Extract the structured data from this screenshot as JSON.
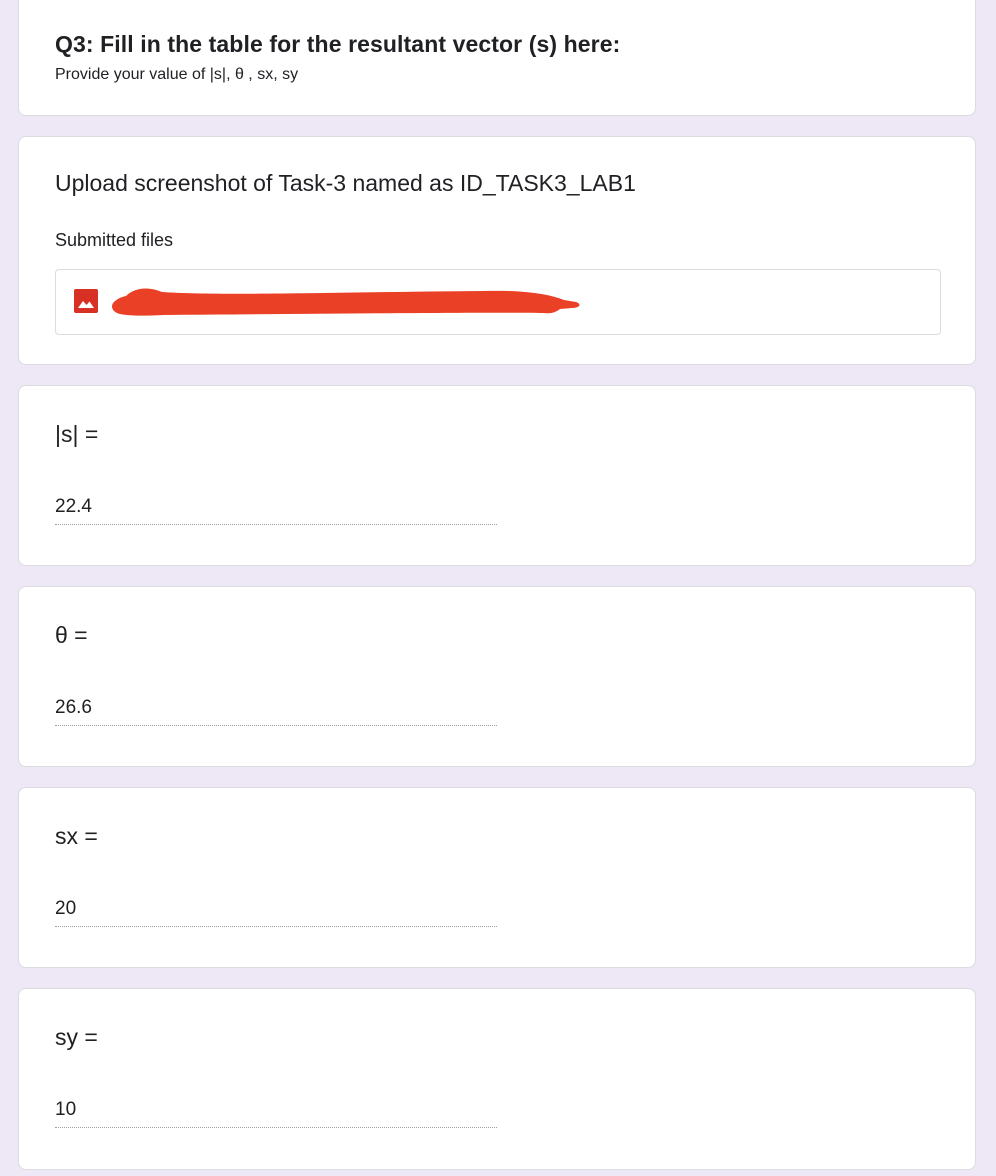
{
  "section": {
    "title": "Q3: Fill in the table for the resultant vector (s) here:",
    "description": "Provide your value of |s|, θ , sx, sy"
  },
  "upload_question": {
    "title": "Upload screenshot of Task-3 named as  ID_TASK3_LAB1",
    "submitted_label": "Submitted files",
    "file_icon": "image-icon",
    "file_name_redacted": true
  },
  "questions": [
    {
      "label": "|s| =",
      "value": "22.4"
    },
    {
      "label": "θ =",
      "value": "26.6"
    },
    {
      "label": "sx =",
      "value": "20"
    },
    {
      "label": "sy =",
      "value": "10"
    }
  ],
  "colors": {
    "background": "#ede7f6",
    "card": "#ffffff",
    "icon_red": "#d93025",
    "redaction": "#ea4026"
  }
}
